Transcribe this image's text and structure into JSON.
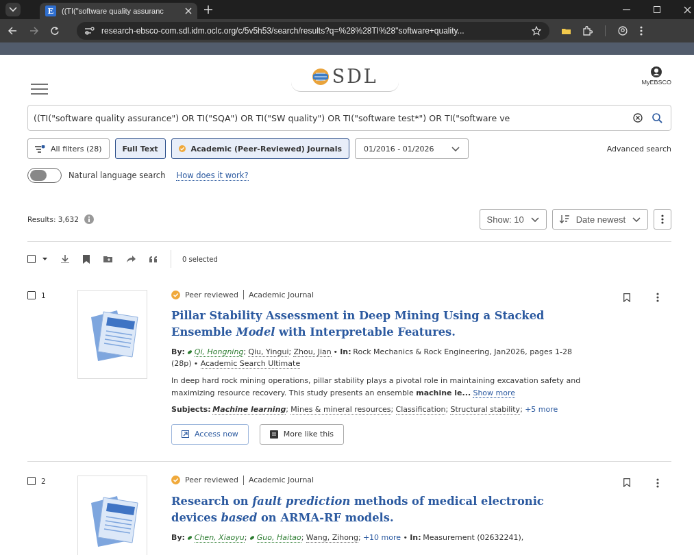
{
  "browser": {
    "favicon": "E",
    "tab_title": "((TI(\"software quality assuranc",
    "url": "research-ebsco-com.sdl.idm.oclc.org/c/5v5h53/search/results?q=%28%28TI%28\"software+quality..."
  },
  "header": {
    "logo": "SDL",
    "account": "MyEBSCO"
  },
  "search": {
    "value": "((TI(\"software quality assurance\") OR TI(\"SQA\") OR TI(\"SW quality\") OR TI(\"software test*\") OR TI(\"software ve"
  },
  "filters": [
    {
      "kind": "filters",
      "label": "All filters (28)",
      "selected": false
    },
    {
      "kind": "chip",
      "label": "Full Text",
      "selected": true
    },
    {
      "kind": "peer",
      "label": "Academic (Peer-Reviewed) Journals",
      "selected": true
    },
    {
      "kind": "dropdown",
      "label": "01/2016 - 01/2026",
      "selected": false
    }
  ],
  "advanced_search": "Advanced search",
  "natural_language": {
    "label": "Natural language search",
    "on": false,
    "link": "How does it work?"
  },
  "results": {
    "count": "Results: 3,632",
    "show": "Show: 10",
    "sort": "Date newest",
    "all_checked": false,
    "selected_count": "0 selected"
  },
  "items": [
    {
      "number": "1",
      "checked": false,
      "badge": "Peer reviewed",
      "type": "Academic Journal",
      "title": "Pillar Stability Assessment in Deep Mining Using a Stacked Ensemble *Model* with Interpretable Features.",
      "byline": [
        {
          "kind": "label",
          "text": "By:"
        },
        {
          "kind": "author",
          "text": "Qi, Hongning",
          "orcid": true
        },
        {
          "kind": "punct",
          "text": ";"
        },
        {
          "kind": "author",
          "text": "Qiu, Yingui",
          "orcid": false
        },
        {
          "kind": "punct",
          "text": ";"
        },
        {
          "kind": "author",
          "text": "Zhou, Jian",
          "orcid": false
        },
        {
          "kind": "plain",
          "text": "•"
        },
        {
          "kind": "label",
          "text": "In:"
        },
        {
          "kind": "plain",
          "text": "Rock Mechanics & Rock Engineering, Jan2026, pages 1-28 (28p)"
        },
        {
          "kind": "plain",
          "text": "•"
        },
        {
          "kind": "source",
          "text": "Academic Search Ultimate"
        }
      ],
      "snippet": "In deep hard rock mining operations, pillar stability plays a pivotal role in maintaining excavation safety and maximizing resource recovery. This study presents an ensemble **machine le...**",
      "show_more": "Show more",
      "subjects": [
        {
          "kind": "label",
          "text": "Subjects:"
        },
        {
          "kind": "subject",
          "text": "Machine learning",
          "match": true
        },
        {
          "kind": "punct",
          "text": ";"
        },
        {
          "kind": "subject",
          "text": "Mines & mineral resources",
          "match": false
        },
        {
          "kind": "punct",
          "text": ";"
        },
        {
          "kind": "subject",
          "text": "Classification",
          "match": false
        },
        {
          "kind": "punct",
          "text": ";"
        },
        {
          "kind": "subject",
          "text": "Structural stability",
          "match": false
        },
        {
          "kind": "punct",
          "text": ";"
        },
        {
          "kind": "more",
          "text": "+5 more"
        }
      ],
      "buttons": [
        {
          "kind": "access",
          "label": "Access now"
        },
        {
          "kind": "similar",
          "label": "More like this"
        }
      ]
    },
    {
      "number": "2",
      "checked": false,
      "badge": "Peer reviewed",
      "type": "Academic Journal",
      "title": "Research on *fault* *prediction* methods of medical electronic devices *based* on ARMA-RF models.",
      "byline": [
        {
          "kind": "label",
          "text": "By:"
        },
        {
          "kind": "author",
          "text": "Chen, Xiaoyu",
          "orcid": true
        },
        {
          "kind": "punct",
          "text": ";"
        },
        {
          "kind": "author",
          "text": "Guo, Haitao",
          "orcid": true
        },
        {
          "kind": "punct",
          "text": ";"
        },
        {
          "kind": "author",
          "text": "Wang, Zihong",
          "orcid": false
        },
        {
          "kind": "punct",
          "text": ";"
        },
        {
          "kind": "more",
          "text": "+10 more"
        },
        {
          "kind": "plain",
          "text": "•"
        },
        {
          "kind": "label",
          "text": "In:"
        },
        {
          "kind": "plain",
          "text": "Measurement (02632241),"
        }
      ]
    }
  ]
}
